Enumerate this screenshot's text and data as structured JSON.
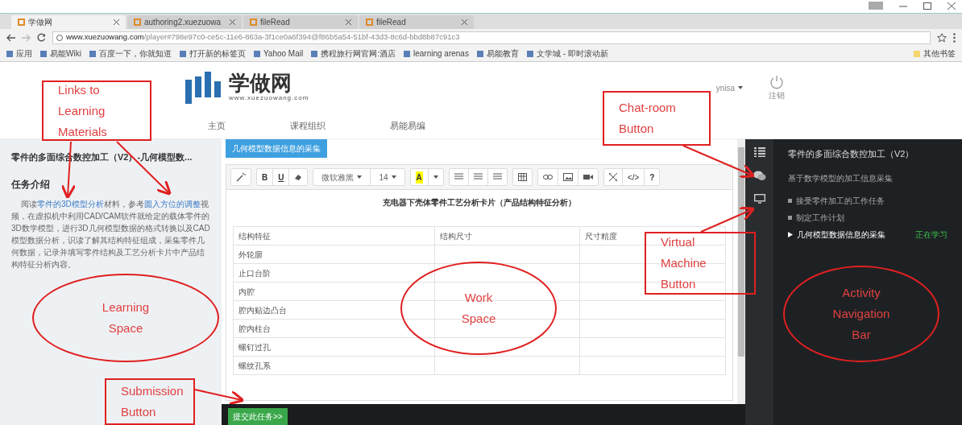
{
  "browser": {
    "tabs": [
      {
        "title": "学做网",
        "selected": true
      },
      {
        "title": "authoring2.xuezuowa",
        "selected": false
      },
      {
        "title": "fileRead",
        "selected": false
      },
      {
        "title": "fileRead",
        "selected": false
      }
    ],
    "address": {
      "host": "www.xuezuowang.com",
      "path": "/player#798e97c0-ce5c-11e6-863a-3f1ce0a6f394@f86b5a54-51bf-43d3-8c6d-bbd8b87c91c3"
    },
    "bookmarks": [
      "应用",
      "易能Wiki",
      "百度一下，你就知道",
      "打开新的标签页",
      "Yahoo Mail",
      "携程旅行网官网:酒店",
      "learning arenas",
      "易能教育",
      "文学城 - 即时滚动新"
    ],
    "other_bookmarks": "其他书签"
  },
  "header": {
    "logo_text": "学做网",
    "logo_url": "www.xuezuowang.com",
    "nav": [
      {
        "label": "主页"
      },
      {
        "label": "课程组织"
      },
      {
        "label": "易能易编"
      }
    ],
    "user": "ynisa",
    "logout": "注销"
  },
  "learning_space": {
    "title": "零件的多面综合数控加工（V2）-几何模型数...",
    "heading": "任务介绍",
    "paragraph": [
      {
        "kind": "text",
        "text": "阅读"
      },
      {
        "kind": "link",
        "text": "零件的3D模型分析"
      },
      {
        "kind": "text",
        "text": "材料，参考"
      },
      {
        "kind": "link",
        "text": "圆入方位的调整"
      },
      {
        "kind": "text",
        "text": "视频，在虚拟机中利用CAD/CAM软件就给定的载体零件的3D数学模型，进行3D几何模型数据的格式转换以及CAD模型数据分析，识读了解其结构特征组成，采集零件几何数据，记录并填写零件结构及工艺分析卡片中产品结构特征分析内容。"
      }
    ]
  },
  "workspace": {
    "tab": "几何模型数据信息的采集",
    "toolbar": [
      [
        {
          "kind": "wand"
        }
      ],
      [
        {
          "kind": "bold",
          "text": "B"
        },
        {
          "kind": "underline",
          "text": "U"
        },
        {
          "kind": "eraser"
        }
      ],
      [
        {
          "kind": "dropdown",
          "text": "微软雅黑"
        },
        {
          "kind": "dropdown",
          "text": "14"
        }
      ],
      [
        {
          "kind": "highlight",
          "text": "A"
        },
        {
          "kind": "caret"
        }
      ],
      [
        {
          "kind": "ul"
        },
        {
          "kind": "ol"
        },
        {
          "kind": "align"
        }
      ],
      [
        {
          "kind": "table"
        }
      ],
      [
        {
          "kind": "link"
        },
        {
          "kind": "image"
        },
        {
          "kind": "video"
        }
      ],
      [
        {
          "kind": "fullscreen"
        },
        {
          "kind": "code",
          "text": "</>"
        },
        {
          "kind": "help",
          "text": "?"
        }
      ]
    ],
    "doc_title": "充电器下壳体零件工艺分析卡片（产品结构特征分析）",
    "columns": [
      "结构特征",
      "结构尺寸",
      "尺寸精度"
    ],
    "rows": [
      "外轮廓",
      "止口台阶",
      "内腔",
      "腔内贴边凸台",
      "腔内柱台",
      "螺钉过孔",
      "螺纹孔系"
    ],
    "submit": "提交此任务>>"
  },
  "activity_nav": {
    "title": "零件的多面综合数控加工（V2）",
    "subtitle": "基于数学模型的加工信息采集",
    "items": [
      {
        "label": "接受零件加工的工作任务",
        "selected": false
      },
      {
        "label": "制定工作计划",
        "selected": false
      },
      {
        "label": "几何模型数据信息的采集",
        "selected": true,
        "status": "正在学习"
      }
    ]
  },
  "annotations": [
    {
      "kind": "box",
      "lines": [
        "Links to",
        "Learning",
        "Materials"
      ]
    },
    {
      "kind": "box",
      "lines": [
        "Chat-room",
        "Button"
      ]
    },
    {
      "kind": "box",
      "lines": [
        "Virtual",
        "Machine",
        "Button"
      ]
    },
    {
      "kind": "ellipse",
      "lines": [
        "Learning",
        "Space"
      ]
    },
    {
      "kind": "ellipse",
      "lines": [
        "Work",
        "Space"
      ]
    },
    {
      "kind": "ellipse",
      "lines": [
        "Activity",
        "Navigation",
        "Bar"
      ]
    },
    {
      "kind": "box",
      "lines": [
        "Submission",
        "Button"
      ]
    }
  ]
}
